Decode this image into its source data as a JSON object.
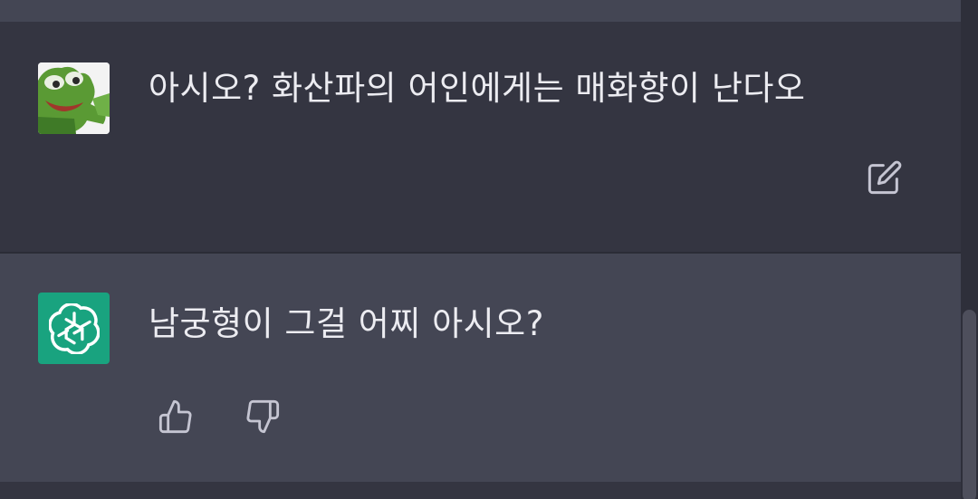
{
  "conversation": {
    "user_message": {
      "text": "아시오? 화산파의 어인에게는 매화향이 난다오",
      "avatar_icon": "frog-avatar-icon",
      "edit_icon": "edit-icon"
    },
    "assistant_message": {
      "text": "남궁형이 그걸 어찌 아시오?",
      "avatar_icon": "openai-logo-icon",
      "thumbs_up_icon": "thumbs-up-icon",
      "thumbs_down_icon": "thumbs-down-icon"
    }
  },
  "colors": {
    "background": "#343541",
    "assistant_background": "#444654",
    "text": "#ececf1",
    "icon": "#c5c5d2",
    "openai_green": "#19a37f"
  }
}
